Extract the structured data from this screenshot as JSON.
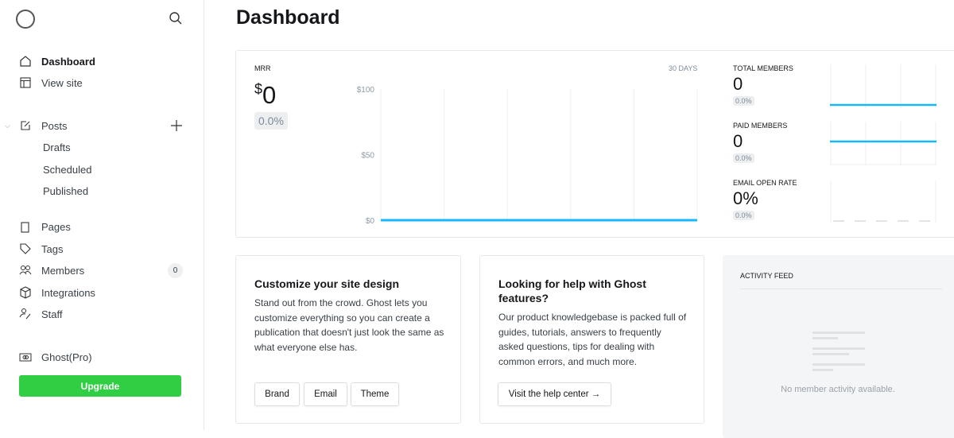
{
  "sidebar": {
    "items": [
      {
        "label": "Dashboard",
        "icon": "home-icon"
      },
      {
        "label": "View site",
        "icon": "layout-icon"
      },
      {
        "label": "Posts",
        "icon": "edit-icon"
      },
      {
        "label": "Drafts"
      },
      {
        "label": "Scheduled"
      },
      {
        "label": "Published"
      },
      {
        "label": "Pages",
        "icon": "page-icon"
      },
      {
        "label": "Tags",
        "icon": "tag-icon"
      },
      {
        "label": "Members",
        "icon": "members-icon",
        "count": "0"
      },
      {
        "label": "Integrations",
        "icon": "cube-icon"
      },
      {
        "label": "Staff",
        "icon": "staff-icon"
      },
      {
        "label": "Ghost(Pro)",
        "icon": "ghost-pro-icon"
      }
    ],
    "upgrade": "Upgrade"
  },
  "page_title": "Dashboard",
  "mrr": {
    "label": "MRR",
    "currency": "$",
    "value": "0",
    "change": "0.0%",
    "range": "30 DAYS",
    "ticks": [
      "$100",
      "$50",
      "$0"
    ]
  },
  "small_stats": [
    {
      "label": "TOTAL MEMBERS",
      "value": "0",
      "change": "0.0%"
    },
    {
      "label": "PAID MEMBERS",
      "value": "0",
      "change": "0.0%"
    },
    {
      "label": "EMAIL OPEN RATE",
      "value": "0%",
      "change": "0.0%"
    }
  ],
  "chart_data": {
    "type": "line",
    "title": "MRR",
    "ylim": [
      0,
      100
    ],
    "yticks": [
      "$100",
      "$50",
      "$0"
    ],
    "values": [
      0,
      0,
      0,
      0,
      0,
      0
    ],
    "color": "#14b8ff"
  },
  "customize": {
    "title": "Customize your site design",
    "body": "Stand out from the crowd. Ghost lets you customize everything so you can create a publication that doesn't just look the same as what everyone else has.",
    "buttons": [
      "Brand",
      "Email",
      "Theme"
    ]
  },
  "help": {
    "title": "Looking for help with Ghost features?",
    "body": "Our product knowledgebase is packed full of guides, tutorials, answers to frequently asked questions, tips for dealing with common errors, and much more.",
    "button": "Visit the help center →"
  },
  "feed": {
    "title": "ACTIVITY FEED",
    "empty": "No member activity available."
  }
}
